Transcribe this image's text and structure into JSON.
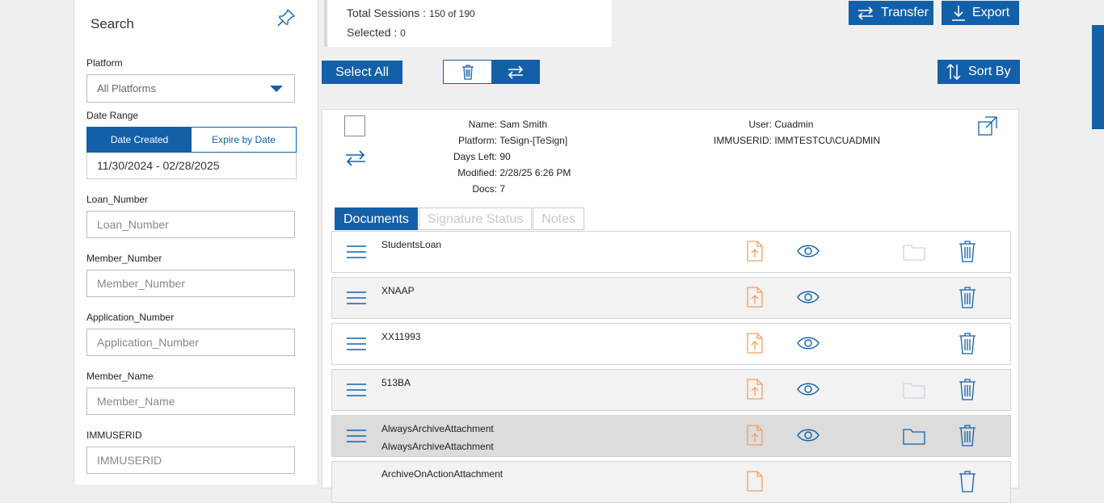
{
  "search": {
    "title": "Search",
    "platform_label": "Platform",
    "platform_value": "All Platforms",
    "date_range_label": "Date Range",
    "date_created_label": "Date Created",
    "expire_by_date_label": "Expire by Date",
    "date_range_value": "11/30/2024 - 02/28/2025",
    "fields": [
      {
        "label": "Loan_Number",
        "placeholder": "Loan_Number"
      },
      {
        "label": "Member_Number",
        "placeholder": "Member_Number"
      },
      {
        "label": "Application_Number",
        "placeholder": "Application_Number"
      },
      {
        "label": "Member_Name",
        "placeholder": "Member_Name"
      },
      {
        "label": "IMMUSERID",
        "placeholder": "IMMUSERID"
      }
    ]
  },
  "summary": {
    "total_label": "Total Sessions :",
    "total_value": "150 of 190",
    "selected_label": "Selected :",
    "selected_value": "0"
  },
  "toolbar": {
    "transfer_label": "Transfer",
    "export_label": "Export",
    "select_all_label": "Select All",
    "sort_by_label": "Sort By"
  },
  "session": {
    "name_label": "Name:",
    "name_value": "Sam Smith",
    "platform_label": "Platform:",
    "platform_value": "TeSign-[TeSign]",
    "days_left_label": "Days Left:",
    "days_left_value": "90",
    "modified_label": "Modified:",
    "modified_value": "2/28/25 6:26 PM",
    "docs_label": "Docs:",
    "docs_value": "7",
    "user_label": "User:",
    "user_value": "Cuadmin",
    "immuserid_label": "IMMUSERID:",
    "immuserid_value": "IMMTESTCU\\CUADMIN"
  },
  "tabs": [
    "Documents",
    "Signature Status",
    "Notes"
  ],
  "documents": [
    {
      "name": "StudentsLoan",
      "sub": ""
    },
    {
      "name": "XNAAP",
      "sub": ""
    },
    {
      "name": "XX11993",
      "sub": ""
    },
    {
      "name": "513BA",
      "sub": ""
    },
    {
      "name": "AlwaysArchiveAttachment",
      "sub": "AlwaysArchiveAttachment"
    },
    {
      "name": "ArchiveOnActionAttachment",
      "sub": ""
    }
  ],
  "colors": {
    "primary": "#1460a8",
    "upload": "#f0a060",
    "folder_faded": "#c9d6e3"
  }
}
